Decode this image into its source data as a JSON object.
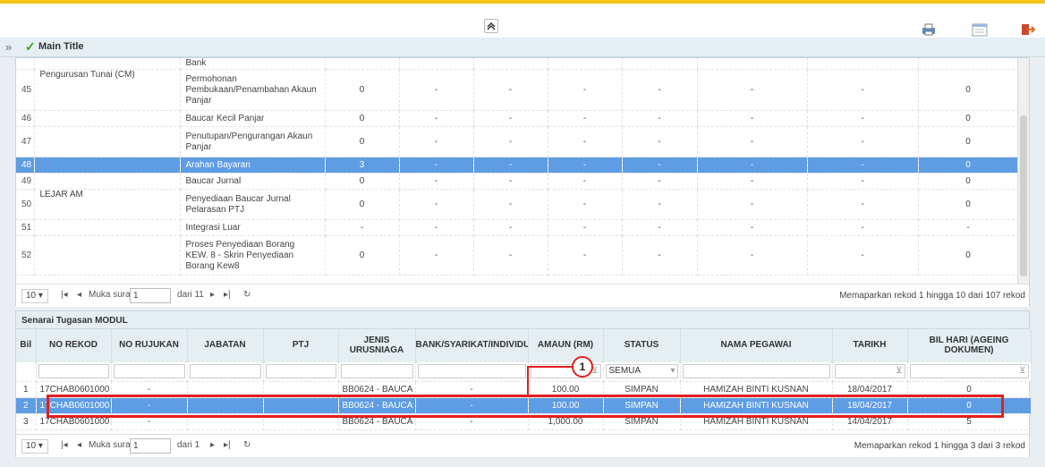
{
  "toolbar": {
    "collapse_glyph": "≈"
  },
  "title_bar": {
    "title": "Main Title"
  },
  "module_table": {
    "rows": [
      {
        "no": "",
        "cat": "",
        "item": "Bank",
        "v0": "",
        "d1": "",
        "d2": "",
        "d3": "",
        "d4": "",
        "d5": "",
        "d6": "",
        "d7": "",
        "v8": ""
      },
      {
        "no": "45",
        "cat": "Pengurusan Tunai (CM)",
        "item": "Permohonan Pembukaan/Penambahan Akaun Panjar",
        "v0": "0",
        "d1": "-",
        "d2": "-",
        "d3": "-",
        "d4": "-",
        "d5": "-",
        "d6": "-",
        "d7": "-",
        "v8": "0"
      },
      {
        "no": "46",
        "cat": "",
        "item": "Baucar Kecil Panjar",
        "v0": "0",
        "d1": "-",
        "d2": "-",
        "d3": "-",
        "d4": "-",
        "d5": "-",
        "d6": "-",
        "d7": "-",
        "v8": "0"
      },
      {
        "no": "47",
        "cat": "",
        "item": "Penutupan/Pengurangan Akaun Panjar",
        "v0": "0",
        "d1": "-",
        "d2": "-",
        "d3": "-",
        "d4": "-",
        "d5": "-",
        "d6": "-",
        "d7": "-",
        "v8": "0"
      },
      {
        "no": "48",
        "cat": "",
        "item": "Arahan Bayaran",
        "v0": "3",
        "d1": "-",
        "d2": "-",
        "d3": "-",
        "d4": "-",
        "d5": "-",
        "d6": "-",
        "d7": "-",
        "v8": "0"
      },
      {
        "no": "49",
        "cat": "",
        "item": "Baucar Jurnal",
        "v0": "0",
        "d1": "-",
        "d2": "-",
        "d3": "-",
        "d4": "-",
        "d5": "-",
        "d6": "-",
        "d7": "-",
        "v8": "0"
      },
      {
        "no": "50",
        "cat": "LEJAR AM",
        "item": "Penyediaan Baucar Jurnal Pelarasan PTJ",
        "v0": "0",
        "d1": "-",
        "d2": "-",
        "d3": "-",
        "d4": "-",
        "d5": "-",
        "d6": "-",
        "d7": "-",
        "v8": "0"
      },
      {
        "no": "51",
        "cat": "",
        "item": "Integrasi Luar",
        "v0": "-",
        "d1": "-",
        "d2": "-",
        "d3": "-",
        "d4": "-",
        "d5": "-",
        "d6": "-",
        "d7": "-",
        "v8": "-"
      },
      {
        "no": "52",
        "cat": "",
        "item": "Proses Penyediaan Borang KEW. 8 - Skrin Penyediaan Borang Kew8",
        "v0": "0",
        "d1": "-",
        "d2": "-",
        "d3": "-",
        "d4": "-",
        "d5": "-",
        "d6": "-",
        "d7": "-",
        "v8": "0"
      }
    ],
    "selected_row": 4
  },
  "pager1": {
    "page_size": "10",
    "page_label": "Muka surat",
    "page": "1",
    "of_label": "dari 11",
    "info": "Memaparkan rekod 1 hingga 10 dari 107 rekod"
  },
  "task_panel": {
    "title": "Senarai Tugasan MODUL",
    "headers": [
      "Bil",
      "NO REKOD",
      "NO RUJUKAN",
      "JABATAN",
      "PTJ",
      "JENIS URUSNIAGA",
      "BANK/SYARIKAT/INDIVIDU",
      "AMAUN (RM)",
      "STATUS",
      "NAMA PEGAWAI",
      "TARIKH",
      "BIL HARI (AGEING DOKUMEN)"
    ],
    "status_filter": "SEMUA",
    "rows": [
      {
        "bil": "1",
        "no_rekod": "17CHAB0601000",
        "no_rujukan": "-",
        "jabatan": "",
        "ptj": "",
        "jenis": "BB0624 - BAUCA",
        "bank": "-",
        "amaun": "100.00",
        "status": "SIMPAN",
        "nama": "HAMIZAH BINTI KUSNAN",
        "tarikh": "18/04/2017",
        "bil_hari": "0"
      },
      {
        "bil": "2",
        "no_rekod": "17CHAB0601000",
        "no_rujukan": "-",
        "jabatan": "",
        "ptj": "",
        "jenis": "BB0624 - BAUCA",
        "bank": "-",
        "amaun": "100.00",
        "status": "SIMPAN",
        "nama": "HAMIZAH BINTI KUSNAN",
        "tarikh": "18/04/2017",
        "bil_hari": "0"
      },
      {
        "bil": "3",
        "no_rekod": "17CHAB0601000",
        "no_rujukan": "-",
        "jabatan": "",
        "ptj": "",
        "jenis": "BB0624 - BAUCA",
        "bank": "-",
        "amaun": "1,000.00",
        "status": "SIMPAN",
        "nama": "HAMIZAH BINTI KUSNAN",
        "tarikh": "14/04/2017",
        "bil_hari": "5"
      }
    ],
    "selected_row": 1
  },
  "pager2": {
    "page_size": "10",
    "page_label": "Muka surat",
    "page": "1",
    "of_label": "dari 1",
    "info": "Memaparkan rekod 1 hingga 3 dari 3 rekod"
  },
  "callout": {
    "label": "1"
  },
  "colors": {
    "accent_yellow": "#f6c616",
    "selection_blue": "#5e9ce4",
    "highlight_red": "#e02020"
  }
}
